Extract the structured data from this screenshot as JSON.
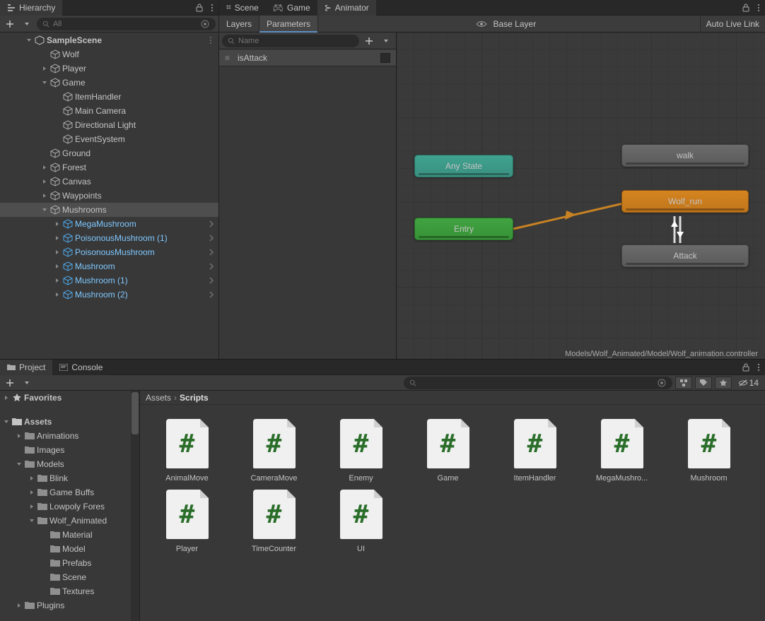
{
  "hierarchy": {
    "tab_label": "Hierarchy",
    "search_placeholder": "All",
    "scene_name": "SampleScene",
    "tree": [
      {
        "level": 1,
        "arrow": "",
        "icon": "go",
        "label": "Wolf"
      },
      {
        "level": 1,
        "arrow": "right",
        "icon": "go",
        "label": "Player"
      },
      {
        "level": 1,
        "arrow": "down",
        "icon": "go",
        "label": "Game"
      },
      {
        "level": 2,
        "arrow": "",
        "icon": "go",
        "label": "ItemHandler"
      },
      {
        "level": 2,
        "arrow": "",
        "icon": "go",
        "label": "Main Camera"
      },
      {
        "level": 2,
        "arrow": "",
        "icon": "go",
        "label": "Directional Light"
      },
      {
        "level": 2,
        "arrow": "",
        "icon": "go",
        "label": "EventSystem"
      },
      {
        "level": 1,
        "arrow": "",
        "icon": "go",
        "label": "Ground"
      },
      {
        "level": 1,
        "arrow": "right",
        "icon": "go",
        "label": "Forest"
      },
      {
        "level": 1,
        "arrow": "right",
        "icon": "go",
        "label": "Canvas"
      },
      {
        "level": 1,
        "arrow": "right",
        "icon": "go",
        "label": "Waypoints"
      },
      {
        "level": 1,
        "arrow": "down",
        "icon": "go",
        "label": "Mushrooms",
        "selected": true
      },
      {
        "level": 2,
        "arrow": "right",
        "icon": "prefab",
        "label": "MegaMushroom",
        "more": true
      },
      {
        "level": 2,
        "arrow": "right",
        "icon": "prefab",
        "label": "PoisonousMushroom (1)",
        "more": true
      },
      {
        "level": 2,
        "arrow": "right",
        "icon": "prefab",
        "label": "PoisonousMushroom",
        "more": true
      },
      {
        "level": 2,
        "arrow": "right",
        "icon": "prefab",
        "label": "Mushroom",
        "more": true
      },
      {
        "level": 2,
        "arrow": "right",
        "icon": "prefab",
        "label": "Mushroom (1)",
        "more": true
      },
      {
        "level": 2,
        "arrow": "right",
        "icon": "prefab",
        "label": "Mushroom (2)",
        "more": true
      }
    ]
  },
  "main_tabs": {
    "scene": "Scene",
    "game": "Game",
    "animator": "Animator"
  },
  "animator": {
    "layers_tab": "Layers",
    "parameters_tab": "Parameters",
    "param_search": "Name",
    "breadcrumb": "Base Layer",
    "auto_live": "Auto Live Link",
    "path": "Models/Wolf_Animated/Model/Wolf_animation.controller",
    "parameters": [
      {
        "name": "isAttack",
        "type": "bool"
      }
    ],
    "nodes": {
      "any_state": "Any State",
      "entry": "Entry",
      "walk": "walk",
      "wolf_run": "Wolf_run",
      "attack": "Attack"
    }
  },
  "bottom": {
    "project_tab": "Project",
    "console_tab": "Console",
    "hidden_count": "14",
    "favorites": "Favorites",
    "assets_root": "Assets",
    "breadcrumb": [
      "Assets",
      "Scripts"
    ],
    "tree": [
      {
        "level": 1,
        "arrow": "right",
        "icon": "folder",
        "label": "Animations"
      },
      {
        "level": 1,
        "arrow": "",
        "icon": "folder",
        "label": "Images"
      },
      {
        "level": 1,
        "arrow": "down",
        "icon": "folder",
        "label": "Models"
      },
      {
        "level": 2,
        "arrow": "right",
        "icon": "folder",
        "label": "Blink"
      },
      {
        "level": 2,
        "arrow": "right",
        "icon": "folder",
        "label": "Game Buffs"
      },
      {
        "level": 2,
        "arrow": "right",
        "icon": "folder",
        "label": "Lowpoly Fores"
      },
      {
        "level": 2,
        "arrow": "down",
        "icon": "folder",
        "label": "Wolf_Animated"
      },
      {
        "level": 3,
        "arrow": "",
        "icon": "folder",
        "label": "Material"
      },
      {
        "level": 3,
        "arrow": "",
        "icon": "folder",
        "label": "Model"
      },
      {
        "level": 3,
        "arrow": "",
        "icon": "folder",
        "label": "Prefabs"
      },
      {
        "level": 3,
        "arrow": "",
        "icon": "folder",
        "label": "Scene"
      },
      {
        "level": 3,
        "arrow": "",
        "icon": "folder",
        "label": "Textures"
      },
      {
        "level": 1,
        "arrow": "right",
        "icon": "folder",
        "label": "Plugins"
      }
    ],
    "assets": [
      "AnimalMove",
      "CameraMove",
      "Enemy",
      "Game",
      "ItemHandler",
      "MegaMushro...",
      "Mushroom",
      "Player",
      "TimeCounter",
      "UI"
    ]
  }
}
